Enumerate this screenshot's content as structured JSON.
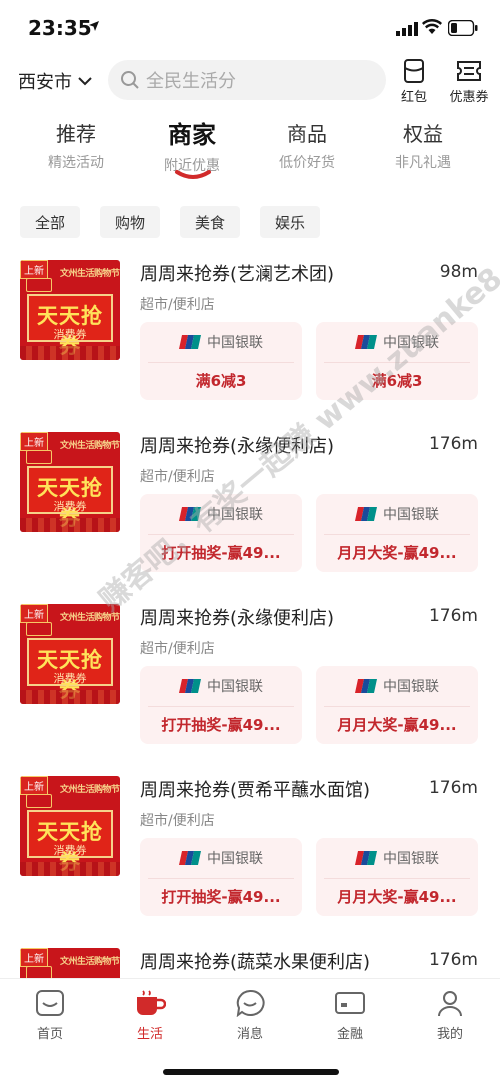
{
  "status": {
    "time": "23:35"
  },
  "header": {
    "city": "西安市",
    "search_placeholder": "全民生活分",
    "red_packet": "红包",
    "coupon": "优惠券"
  },
  "tabs": [
    {
      "title": "推荐",
      "subtitle": "精选活动"
    },
    {
      "title": "商家",
      "subtitle": "附近优惠",
      "active": true
    },
    {
      "title": "商品",
      "subtitle": "低价好货"
    },
    {
      "title": "权益",
      "subtitle": "非凡礼遇"
    }
  ],
  "filters": [
    "全部",
    "购物",
    "美食",
    "娱乐"
  ],
  "store_image": {
    "badge": "上新",
    "brand": "文州生活购物节",
    "headline": "天天抢券",
    "caption": "消费券"
  },
  "stores": [
    {
      "name": "周周来抢券(艺澜艺术团)",
      "distance": "98m",
      "category": "超市/便利店",
      "coupons": [
        {
          "bank": "中国银联",
          "value": "满6减3"
        },
        {
          "bank": "中国银联",
          "value": "满6减3"
        }
      ]
    },
    {
      "name": "周周来抢券(永缘便利店)",
      "distance": "176m",
      "category": "超市/便利店",
      "coupons": [
        {
          "bank": "中国银联",
          "value": "打开抽奖-赢49..."
        },
        {
          "bank": "中国银联",
          "value": "月月大奖-赢49..."
        }
      ]
    },
    {
      "name": "周周来抢券(永缘便利店)",
      "distance": "176m",
      "category": "超市/便利店",
      "coupons": [
        {
          "bank": "中国银联",
          "value": "打开抽奖-赢49..."
        },
        {
          "bank": "中国银联",
          "value": "月月大奖-赢49..."
        }
      ]
    },
    {
      "name": "周周来抢券(贾希平蘸水面馆)",
      "distance": "176m",
      "category": "超市/便利店",
      "coupons": [
        {
          "bank": "中国银联",
          "value": "打开抽奖-赢49..."
        },
        {
          "bank": "中国银联",
          "value": "月月大奖-赢49..."
        }
      ]
    },
    {
      "name": "周周来抢券(蔬菜水果便利店)",
      "distance": "176m",
      "category": "",
      "coupons": []
    }
  ],
  "watermark": "赚客吧，有奖一起赚 www.zuanke8.com",
  "bottom_nav": [
    {
      "label": "首页",
      "icon": "home-icon"
    },
    {
      "label": "生活",
      "icon": "life-cup-icon",
      "active": true
    },
    {
      "label": "消息",
      "icon": "message-icon"
    },
    {
      "label": "金融",
      "icon": "finance-card-icon"
    },
    {
      "label": "我的",
      "icon": "profile-icon"
    }
  ],
  "colors": {
    "accent": "#d12a2a",
    "coupon_bg": "#fdf1f1",
    "coupon_text": "#c2272d"
  }
}
